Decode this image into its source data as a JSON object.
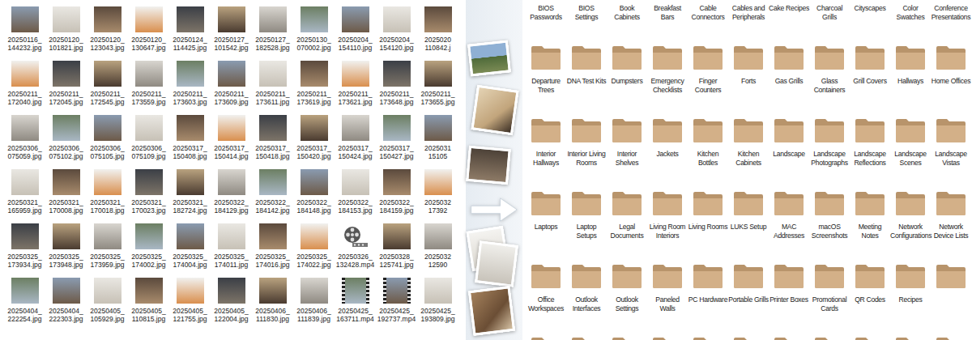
{
  "files": [
    {
      "lines": [
        "20250116_",
        "144232.jpg"
      ],
      "kind": "photo"
    },
    {
      "lines": [
        "20250120_",
        "101821.jpg"
      ],
      "kind": "photo"
    },
    {
      "lines": [
        "20250120_",
        "123043.jpg"
      ],
      "kind": "photo"
    },
    {
      "lines": [
        "20250120_",
        "130647.jpg"
      ],
      "kind": "photo"
    },
    {
      "lines": [
        "20250124_",
        "114425.jpg"
      ],
      "kind": "photo"
    },
    {
      "lines": [
        "20250127_",
        "101542.jpg"
      ],
      "kind": "photo"
    },
    {
      "lines": [
        "20250127_",
        "182528.jpg"
      ],
      "kind": "photo"
    },
    {
      "lines": [
        "20250130_",
        "070002.jpg"
      ],
      "kind": "photo"
    },
    {
      "lines": [
        "20250204_",
        "154110.jpg"
      ],
      "kind": "photo"
    },
    {
      "lines": [
        "20250204_",
        "154120.jpg"
      ],
      "kind": "photo"
    },
    {
      "lines": [
        "2025020",
        "110842.j"
      ],
      "kind": "photo"
    },
    {
      "lines": [
        "20250211_",
        "172040.jpg"
      ],
      "kind": "photo"
    },
    {
      "lines": [
        "20250211_",
        "172045.jpg"
      ],
      "kind": "photo"
    },
    {
      "lines": [
        "20250211_",
        "172545.jpg"
      ],
      "kind": "photo"
    },
    {
      "lines": [
        "20250211_",
        "173559.jpg"
      ],
      "kind": "photo"
    },
    {
      "lines": [
        "20250211_",
        "173603.jpg"
      ],
      "kind": "photo"
    },
    {
      "lines": [
        "20250211_",
        "173609.jpg"
      ],
      "kind": "photo"
    },
    {
      "lines": [
        "20250211_",
        "173611.jpg"
      ],
      "kind": "photo"
    },
    {
      "lines": [
        "20250211_",
        "173619.jpg"
      ],
      "kind": "photo"
    },
    {
      "lines": [
        "20250211_",
        "173621.jpg"
      ],
      "kind": "photo"
    },
    {
      "lines": [
        "20250211_",
        "173648.jpg"
      ],
      "kind": "photo"
    },
    {
      "lines": [
        "20250211_",
        "173655.jpg"
      ],
      "kind": "photo"
    },
    {
      "lines": [
        "20250306_",
        "075059.jpg"
      ],
      "kind": "photo"
    },
    {
      "lines": [
        "20250306_",
        "075102.jpg"
      ],
      "kind": "photo"
    },
    {
      "lines": [
        "20250306_",
        "075105.jpg"
      ],
      "kind": "photo"
    },
    {
      "lines": [
        "20250306_",
        "075109.jpg"
      ],
      "kind": "photo"
    },
    {
      "lines": [
        "20250317_",
        "150408.jpg"
      ],
      "kind": "photo"
    },
    {
      "lines": [
        "20250317_",
        "150414.jpg"
      ],
      "kind": "photo"
    },
    {
      "lines": [
        "20250317_",
        "150418.jpg"
      ],
      "kind": "photo"
    },
    {
      "lines": [
        "20250317_",
        "150420.jpg"
      ],
      "kind": "photo"
    },
    {
      "lines": [
        "20250317_",
        "150424.jpg"
      ],
      "kind": "photo"
    },
    {
      "lines": [
        "20250317_",
        "150427.jpg"
      ],
      "kind": "photo"
    },
    {
      "lines": [
        "2025031",
        "15105"
      ],
      "kind": "photo"
    },
    {
      "lines": [
        "20250321_",
        "165959.jpg"
      ],
      "kind": "photo"
    },
    {
      "lines": [
        "20250321_",
        "170008.jpg"
      ],
      "kind": "photo"
    },
    {
      "lines": [
        "20250321_",
        "170018.jpg"
      ],
      "kind": "photo"
    },
    {
      "lines": [
        "20250321_",
        "170023.jpg"
      ],
      "kind": "photo"
    },
    {
      "lines": [
        "20250321_",
        "182724.jpg"
      ],
      "kind": "photo"
    },
    {
      "lines": [
        "20250322_",
        "184129.jpg"
      ],
      "kind": "photo"
    },
    {
      "lines": [
        "20250322_",
        "184142.jpg"
      ],
      "kind": "photo"
    },
    {
      "lines": [
        "20250322_",
        "184148.jpg"
      ],
      "kind": "photo"
    },
    {
      "lines": [
        "20250322_",
        "184153.jpg"
      ],
      "kind": "photo"
    },
    {
      "lines": [
        "20250322_",
        "184159.jpg"
      ],
      "kind": "photo"
    },
    {
      "lines": [
        "2025032",
        "17392"
      ],
      "kind": "photo"
    },
    {
      "lines": [
        "20250325_",
        "173934.jpg"
      ],
      "kind": "photo"
    },
    {
      "lines": [
        "20250325_",
        "173948.jpg"
      ],
      "kind": "photo"
    },
    {
      "lines": [
        "20250325_",
        "173959.jpg"
      ],
      "kind": "photo"
    },
    {
      "lines": [
        "20250325_",
        "174002.jpg"
      ],
      "kind": "photo"
    },
    {
      "lines": [
        "20250325_",
        "174004.jpg"
      ],
      "kind": "photo"
    },
    {
      "lines": [
        "20250325_",
        "174011.jpg"
      ],
      "kind": "photo"
    },
    {
      "lines": [
        "20250325_",
        "174016.jpg"
      ],
      "kind": "photo"
    },
    {
      "lines": [
        "20250325_",
        "174022.jpg"
      ],
      "kind": "photo"
    },
    {
      "lines": [
        "20250326_",
        "132428.mp4"
      ],
      "kind": "reel"
    },
    {
      "lines": [
        "20250328_",
        "125741.jpg"
      ],
      "kind": "photo"
    },
    {
      "lines": [
        "2025032",
        "12590"
      ],
      "kind": "photo"
    },
    {
      "lines": [
        "20250404_",
        "222254.jpg"
      ],
      "kind": "photo"
    },
    {
      "lines": [
        "20250404_",
        "222303.jpg"
      ],
      "kind": "photo"
    },
    {
      "lines": [
        "20250405_",
        "105929.jpg"
      ],
      "kind": "photo"
    },
    {
      "lines": [
        "20250405_",
        "110815.jpg"
      ],
      "kind": "photo"
    },
    {
      "lines": [
        "20250405_",
        "121755.jpg"
      ],
      "kind": "photo"
    },
    {
      "lines": [
        "20250405_",
        "122004.jpg"
      ],
      "kind": "photo"
    },
    {
      "lines": [
        "20250406_",
        "111830.jpg"
      ],
      "kind": "photo"
    },
    {
      "lines": [
        "20250406_",
        "111839.jpg"
      ],
      "kind": "photo"
    },
    {
      "lines": [
        "20250425_",
        "163711.mp4"
      ],
      "kind": "video"
    },
    {
      "lines": [
        "20250425_",
        "192737.mp4"
      ],
      "kind": "video"
    },
    {
      "lines": [
        "20250425_",
        "193809.jpg"
      ],
      "kind": "photo"
    }
  ],
  "folders": [
    {
      "label": "BIOS Passwords"
    },
    {
      "label": "BIOS Settings"
    },
    {
      "label": "Book Cabinets"
    },
    {
      "label": "Breakfast Bars"
    },
    {
      "label": "Cable Connectors"
    },
    {
      "label": "Cables and Peripherals"
    },
    {
      "label": "Cake Recipes"
    },
    {
      "label": "Charcoal Grills"
    },
    {
      "label": "Cityscapes"
    },
    {
      "label": "Color Swatches"
    },
    {
      "label": "Conference Presentations"
    },
    {
      "label": "Departure Trees"
    },
    {
      "label": "DNA Test Kits"
    },
    {
      "label": "Dumpsters"
    },
    {
      "label": "Emergency Checklists"
    },
    {
      "label": "Finger Counters"
    },
    {
      "label": "Forts"
    },
    {
      "label": "Gas Grills"
    },
    {
      "label": "Glass Containers"
    },
    {
      "label": "Grill Covers"
    },
    {
      "label": "Hallways"
    },
    {
      "label": "Home Offices"
    },
    {
      "label": "Interior Hallways"
    },
    {
      "label": "Interior Living Rooms"
    },
    {
      "label": "Interior Shelves"
    },
    {
      "label": "Jackets"
    },
    {
      "label": "Kitchen Bottles"
    },
    {
      "label": "Kitchen Cabinets"
    },
    {
      "label": "Landscape"
    },
    {
      "label": "Landscape Photographs"
    },
    {
      "label": "Landscape Reflections"
    },
    {
      "label": "Landscape Scenes"
    },
    {
      "label": "Landscape Vistas"
    },
    {
      "label": "Laptops"
    },
    {
      "label": "Laptop Setups"
    },
    {
      "label": "Legal Documents"
    },
    {
      "label": "Living Room Interiors"
    },
    {
      "label": "Living Rooms"
    },
    {
      "label": "LUKS Setup"
    },
    {
      "label": "MAC Addresses"
    },
    {
      "label": "macOS Screenshots"
    },
    {
      "label": "Meeting Notes"
    },
    {
      "label": "Network Configurations"
    },
    {
      "label": "Network Device Lists"
    },
    {
      "label": "Office Workspaces"
    },
    {
      "label": "Outlook Interfaces"
    },
    {
      "label": "Outlook Settings"
    },
    {
      "label": "Paneled Walls"
    },
    {
      "label": "PC Hardware"
    },
    {
      "label": "Portable Grills"
    },
    {
      "label": "Printer Boxes"
    },
    {
      "label": "Promotional Cards"
    },
    {
      "label": "QR Codes"
    },
    {
      "label": "Recipes"
    },
    {
      "label": ""
    },
    {
      "label": ""
    },
    {
      "label": ""
    },
    {
      "label": ""
    },
    {
      "label": ""
    },
    {
      "label": ""
    },
    {
      "label": ""
    },
    {
      "label": ""
    },
    {
      "label": ""
    },
    {
      "label": ""
    },
    {
      "label": ""
    },
    {
      "label": ""
    }
  ]
}
